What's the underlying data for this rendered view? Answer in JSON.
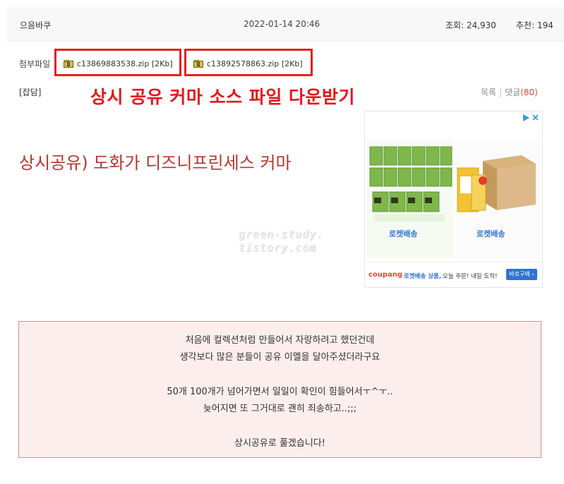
{
  "header": {
    "nickname": "으음바쿠",
    "datetime": "2022-01-14 20:46",
    "views_label": "조회: 24,930",
    "recommend_label": "추천: 194"
  },
  "attachments": {
    "label": "첨부파일",
    "files": [
      {
        "name": "c13869883538.zip [2Kb]"
      },
      {
        "name": "c13892578863.zip [2Kb]"
      }
    ]
  },
  "post": {
    "category": "[잡담]",
    "promo_heading": "상시 공유 커마 소스 파일 다운받기",
    "list_label": "목록",
    "comments_label": "댓글",
    "comments_count": "(80)",
    "title": "상시공유) 도화가 디즈니프린세스 커마",
    "watermark_line1": "green-study.",
    "watermark_line2": "tistory.com"
  },
  "ad": {
    "left_rocket": "로켓배송",
    "right_rocket": "로켓배송",
    "brand": "coupang",
    "rocket_tag": "로켓배송 상품,",
    "message": "오늘 주문! 내일 도착!",
    "buy_label": "바로구매 ›",
    "accent_color": "#2f74d0"
  },
  "notice": {
    "lines": [
      "처음에 컬렉션처럼 만들어서 자랑하려고 했던건데",
      "생각보다 많은 분들이 공유 이멜을 달아주셨더라구요",
      "",
      "50개 100개가 넘어가면서 일일이 확인이 힘들어서ㅜ^ㅜ..",
      "늦어지면 또 그거대로 괜히 죄송하고..;;;",
      "",
      "상시공유로 풀겠습니다!"
    ]
  },
  "colors": {
    "highlight_red": "#e2231a",
    "title_red": "#b5362f",
    "notice_bg": "#fdeeee",
    "notice_border": "#d98f8f"
  }
}
